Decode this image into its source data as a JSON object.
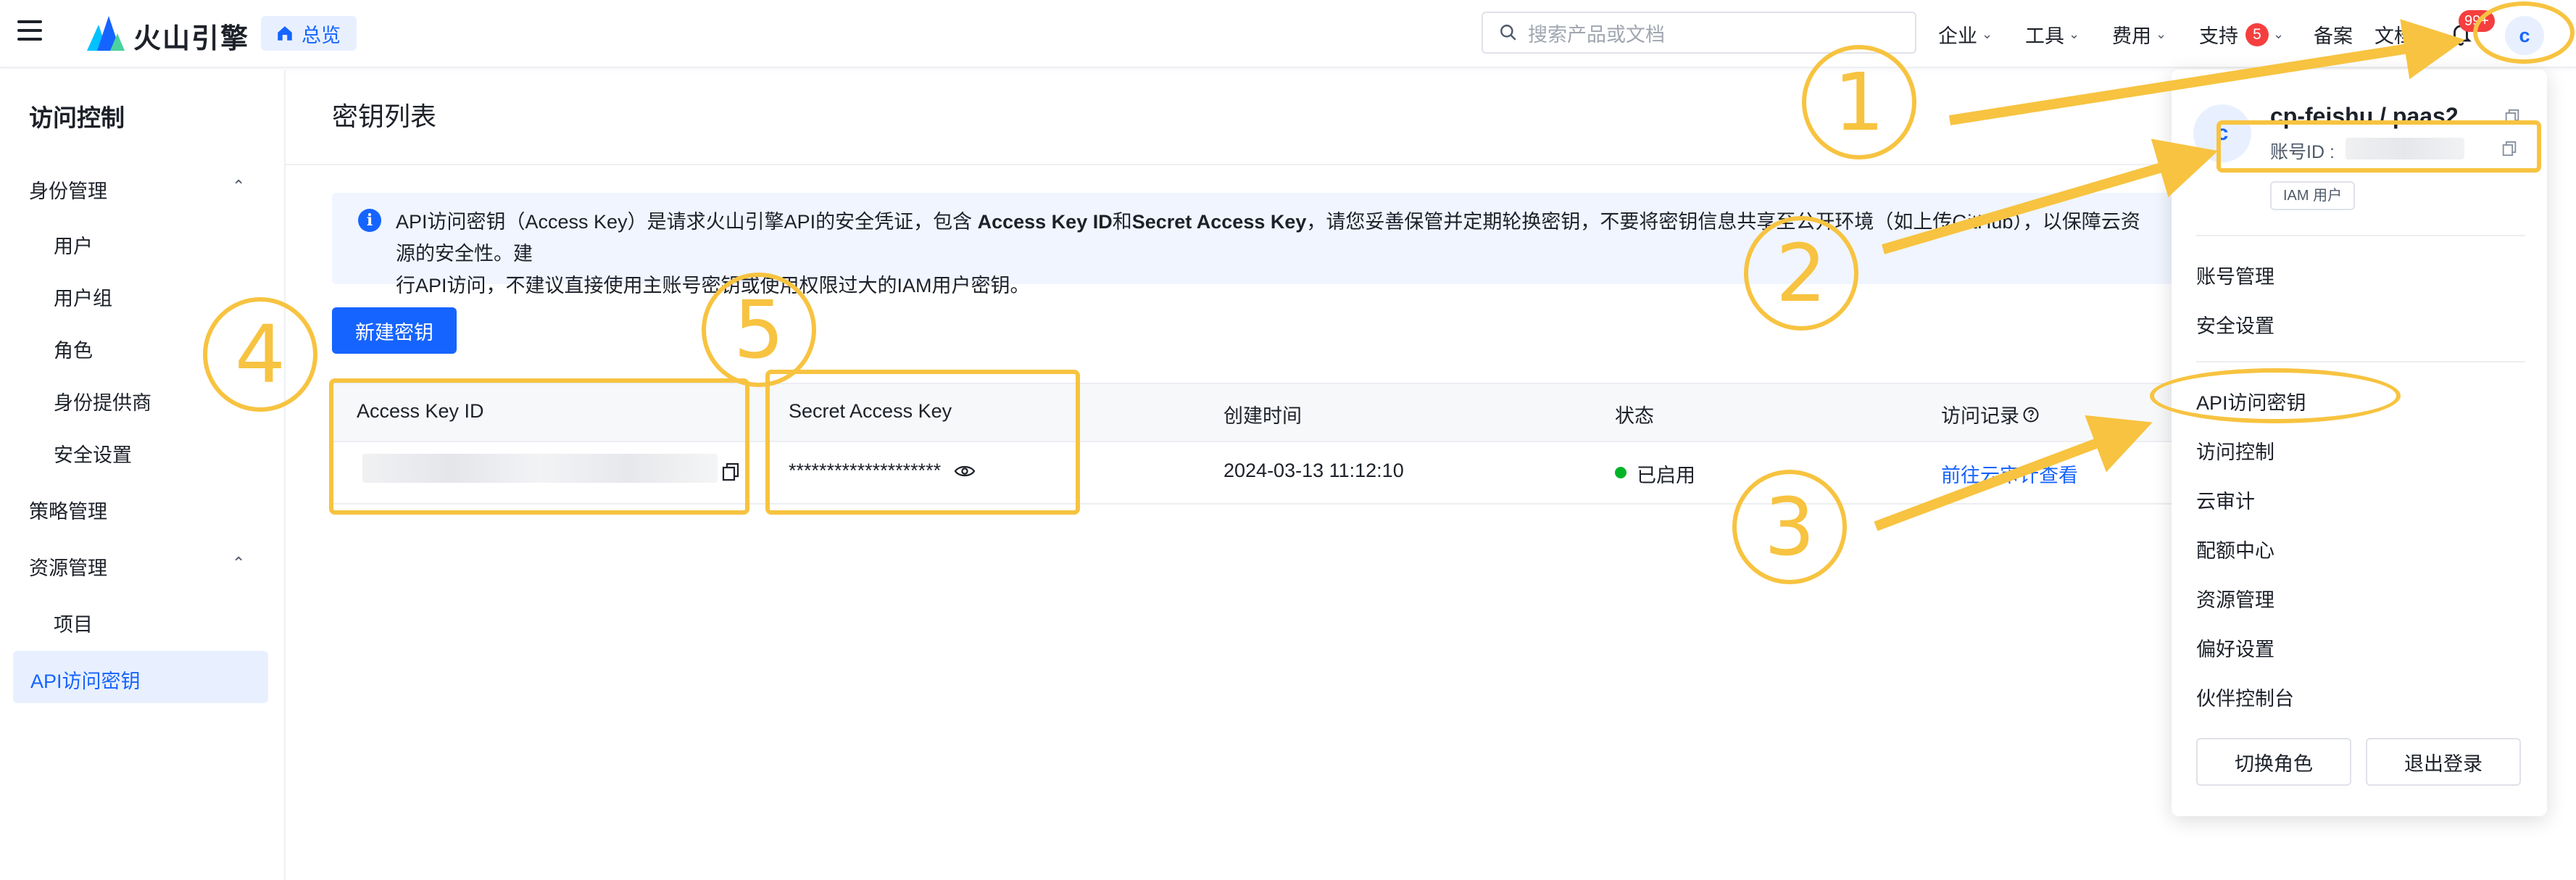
{
  "header": {
    "brand": "火山引擎",
    "home_label": "总览",
    "search_placeholder": "搜索产品或文档",
    "nav": [
      {
        "label": "企业",
        "dropdown": true
      },
      {
        "label": "工具",
        "dropdown": true
      },
      {
        "label": "费用",
        "dropdown": true
      },
      {
        "label": "支持",
        "dropdown": true,
        "badge": "5"
      },
      {
        "label": "备案",
        "dropdown": false
      },
      {
        "label": "文档",
        "dropdown": false
      }
    ],
    "notification_badge": "99+",
    "avatar_letter": "c"
  },
  "sidebar": {
    "title": "访问控制",
    "groups": [
      {
        "label": "身份管理",
        "expanded": true,
        "items": [
          "用户",
          "用户组",
          "角色",
          "身份提供商",
          "安全设置"
        ]
      },
      {
        "label": "策略管理"
      },
      {
        "label": "资源管理",
        "expanded": true,
        "items": [
          "项目"
        ]
      }
    ],
    "active_item": "API访问密钥"
  },
  "main": {
    "title": "密钥列表",
    "notice": {
      "part1": "API访问密钥（Access Key）是请求火山引擎API的安全凭证，包含 ",
      "bold1": "Access Key ID",
      "part2": "和",
      "bold2": "Secret Access Key",
      "part3": "，请您妥善保管并定期轮换密钥，不要将密钥信息共享至公开环境（如上传GitHub），以保障云资源的安全性。建",
      "line2": "行API访问，不建议直接使用主账号密钥或使用权限过大的IAM用户密钥。"
    },
    "new_key_button": "新建密钥",
    "table": {
      "headers": [
        "Access Key ID",
        "Secret Access Key",
        "创建时间",
        "状态",
        "访问记录"
      ],
      "rows": [
        {
          "secret": "********************",
          "created": "2024-03-13 11:12:10",
          "status": "已启用",
          "record_link": "前往云审计查看"
        }
      ]
    }
  },
  "account_menu": {
    "avatar_letter": "c",
    "name": "cp-feishu / paas2",
    "account_id_label": "账号ID :",
    "tag": "IAM 用户",
    "items_a": [
      "账号管理",
      "安全设置"
    ],
    "items_b": [
      "API访问密钥",
      "访问控制",
      "云审计",
      "配额中心",
      "资源管理",
      "偏好设置",
      "伙伴控制台"
    ],
    "buttons": [
      "切换角色",
      "退出登录"
    ]
  },
  "annotations": {
    "color": "#f7c340",
    "numbers": [
      "1",
      "2",
      "3",
      "4",
      "5"
    ]
  },
  "colors": {
    "primary": "#1664ff",
    "success": "#00b42a",
    "danger": "#f53f3f",
    "notice_bg": "#f0f5ff"
  }
}
